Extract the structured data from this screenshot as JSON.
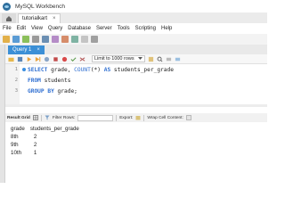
{
  "window": {
    "title": "MySQL Workbench"
  },
  "connection_tab": {
    "label": "tutorialkart",
    "close": "×"
  },
  "menu": [
    "File",
    "Edit",
    "View",
    "Query",
    "Database",
    "Server",
    "Tools",
    "Scripting",
    "Help"
  ],
  "query_tab": {
    "label": "Query 1",
    "close": "×"
  },
  "editor_toolbar": {
    "limit_label": "Limit to 1000 rows"
  },
  "editor": {
    "lines": [
      {
        "number": "1",
        "parts": {
          "kw1": "SELECT",
          "t1": " grade, ",
          "fn1": "COUNT",
          "t2": "(*) ",
          "kw2": "AS",
          "t3": " students_per_grade"
        }
      },
      {
        "number": "2",
        "parts": {
          "kw1": "FROM",
          "t1": " students"
        }
      },
      {
        "number": "3",
        "parts": {
          "kw1": "GROUP BY",
          "t1": " grade;"
        }
      }
    ]
  },
  "results_toolbar": {
    "result_grid": "Result Grid",
    "filter_rows": "Filter Rows:",
    "export": "Export:",
    "wrap": "Wrap Cell Content:"
  },
  "results": {
    "columns": [
      "grade",
      "students_per_grade"
    ],
    "rows": [
      [
        "8th",
        "2"
      ],
      [
        "9th",
        "2"
      ],
      [
        "10th",
        "1"
      ]
    ]
  },
  "colors": {
    "accent": "#3b8fd6",
    "keyword": "#2f6fd1"
  }
}
